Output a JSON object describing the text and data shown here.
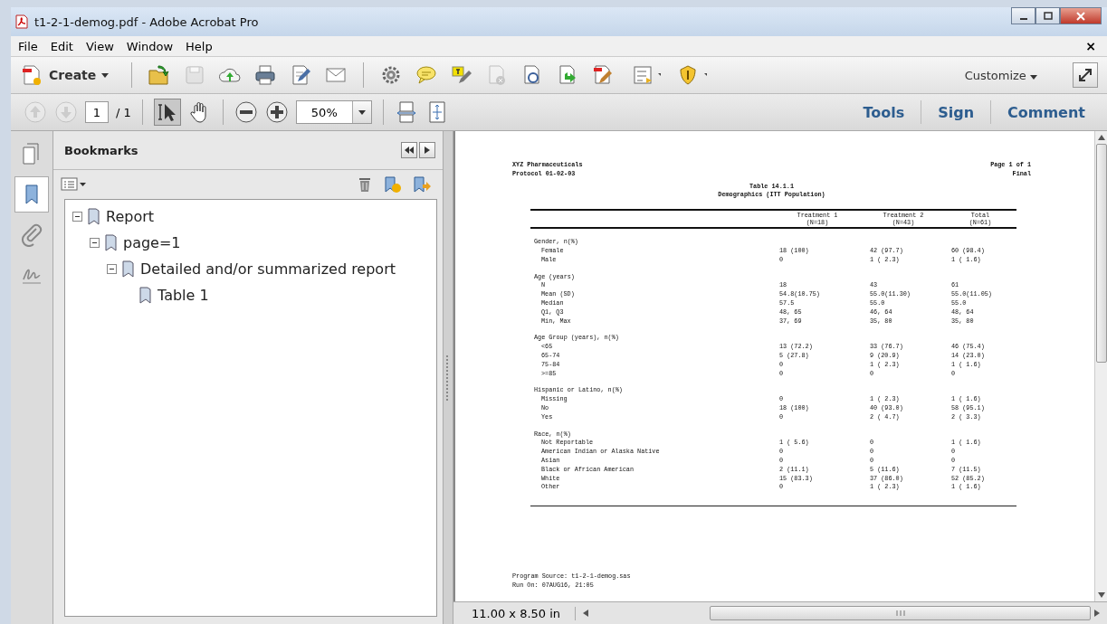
{
  "window": {
    "title": "t1-2-1-demog.pdf - Adobe Acrobat Pro"
  },
  "menu": {
    "items": [
      "File",
      "Edit",
      "View",
      "Window",
      "Help"
    ],
    "close": "×"
  },
  "toolbar": {
    "create": "Create",
    "tools": [
      {
        "kind": "open",
        "disabled": false
      },
      {
        "kind": "save",
        "disabled": true
      },
      {
        "kind": "upload",
        "disabled": false
      },
      {
        "kind": "print",
        "disabled": false
      },
      {
        "kind": "edit",
        "disabled": false
      },
      {
        "kind": "mail",
        "disabled": false
      },
      {
        "kind": "gear",
        "disabled": false
      },
      {
        "kind": "comment",
        "disabled": false
      },
      {
        "kind": "highlight",
        "disabled": false
      },
      {
        "kind": "doc-x",
        "disabled": true
      },
      {
        "kind": "doc-link",
        "disabled": false
      },
      {
        "kind": "doc-arrow",
        "disabled": false
      },
      {
        "kind": "doc-pen",
        "disabled": false
      },
      {
        "kind": "form",
        "disabled": false
      },
      {
        "kind": "shield",
        "disabled": false
      }
    ],
    "customize": "Customize"
  },
  "navbar": {
    "page": "1",
    "total": "/ 1",
    "zoom": "50%",
    "panes": [
      {
        "label": "Tools"
      },
      {
        "label": "Sign"
      },
      {
        "label": "Comment"
      }
    ]
  },
  "side_tabs": [
    {
      "kind": "pages",
      "selected": false
    },
    {
      "kind": "bookmarks",
      "selected": true
    },
    {
      "kind": "attachments",
      "selected": false
    },
    {
      "kind": "signatures",
      "selected": false
    }
  ],
  "bookmarks": {
    "title": "Bookmarks",
    "tree": [
      {
        "label": "Report",
        "expanded": true,
        "children": [
          {
            "label": "page=1",
            "expanded": true,
            "children": [
              {
                "label": "Detailed and/or summarized report",
                "expanded": true,
                "children": [
                  {
                    "label": "Table 1"
                  }
                ]
              }
            ]
          }
        ]
      }
    ]
  },
  "document": {
    "header_left": [
      "XYZ Pharmaceuticals",
      "Protocol 01-02-03"
    ],
    "header_right": [
      "Page 1 of 1",
      "Final"
    ],
    "title": "Table 14.1.1",
    "subtitle": "Demographics (ITT Population)",
    "columns": [
      {
        "label": "Treatment 1",
        "n": "(N=18)"
      },
      {
        "label": "Treatment 2",
        "n": "(N=43)"
      },
      {
        "label": "Total",
        "n": "(N=61)"
      }
    ],
    "sections": [
      {
        "heading": "Gender, n(%)",
        "rows": [
          {
            "label": "Female",
            "values": [
              "18 (100)",
              "42 (97.7)",
              "60 (98.4)"
            ]
          },
          {
            "label": "Male",
            "values": [
              "0",
              "1 ( 2.3)",
              "1 ( 1.6)"
            ]
          }
        ]
      },
      {
        "heading": "Age (years)",
        "rows": [
          {
            "label": "N",
            "values": [
              "18",
              "43",
              "61"
            ]
          },
          {
            "label": "Mean (SD)",
            "values": [
              "54.8(10.75)",
              "55.0(11.30)",
              "55.0(11.05)"
            ]
          },
          {
            "label": "Median",
            "values": [
              "57.5",
              "55.0",
              "55.0"
            ]
          },
          {
            "label": "Q1, Q3",
            "values": [
              "48, 65",
              "46, 64",
              "48, 64"
            ]
          },
          {
            "label": "Min, Max",
            "values": [
              "37, 69",
              "35, 80",
              "35, 80"
            ]
          }
        ]
      },
      {
        "heading": "Age Group (years), n(%)",
        "rows": [
          {
            "label": "<65",
            "values": [
              "13 (72.2)",
              "33 (76.7)",
              "46 (75.4)"
            ]
          },
          {
            "label": "65-74",
            "values": [
              "5 (27.8)",
              "9 (20.9)",
              "14 (23.0)"
            ]
          },
          {
            "label": "75-84",
            "values": [
              "0",
              "1 ( 2.3)",
              "1 ( 1.6)"
            ]
          },
          {
            "label": ">=85",
            "values": [
              "0",
              "0",
              "0"
            ]
          }
        ]
      },
      {
        "heading": "Hispanic or Latino, n(%)",
        "rows": [
          {
            "label": "Missing",
            "values": [
              "0",
              "1 ( 2.3)",
              "1 ( 1.6)"
            ]
          },
          {
            "label": "No",
            "values": [
              "18 (100)",
              "40 (93.0)",
              "58 (95.1)"
            ]
          },
          {
            "label": "Yes",
            "values": [
              "0",
              "2 ( 4.7)",
              "2 ( 3.3)"
            ]
          }
        ]
      },
      {
        "heading": "Race, n(%)",
        "rows": [
          {
            "label": "Not Reportable",
            "values": [
              "1 ( 5.6)",
              "0",
              "1 ( 1.6)"
            ]
          },
          {
            "label": "American Indian or Alaska Native",
            "values": [
              "0",
              "0",
              "0"
            ]
          },
          {
            "label": "Asian",
            "values": [
              "0",
              "0",
              "0"
            ]
          },
          {
            "label": "Black or African American",
            "values": [
              "2 (11.1)",
              "5 (11.6)",
              "7 (11.5)"
            ]
          },
          {
            "label": "White",
            "values": [
              "15 (83.3)",
              "37 (86.0)",
              "52 (85.2)"
            ]
          },
          {
            "label": "Other",
            "values": [
              "0",
              "1 ( 2.3)",
              "1 ( 1.6)"
            ]
          }
        ]
      }
    ],
    "footer": [
      "Program Source: t1-2-1-demog.sas",
      "Run On: 07AUG16, 21:05"
    ]
  },
  "status_bar": {
    "page_size": "11.00 x 8.50 in"
  }
}
